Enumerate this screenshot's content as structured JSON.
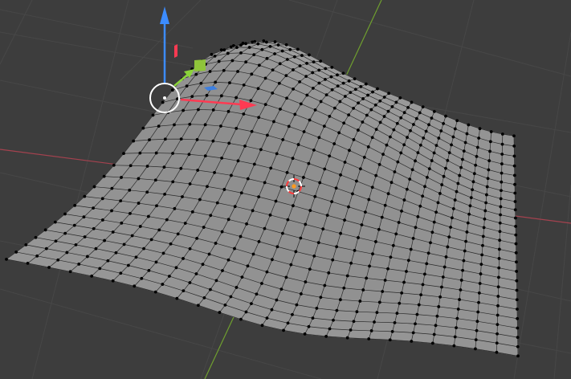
{
  "viewport": {
    "kind": "3d-viewport",
    "mode": "edit-mode",
    "background_color": "#3d3d3d",
    "grid_color": "#474747"
  },
  "axes": {
    "x_axis_color": "#a5424f",
    "y_axis_color": "#6f9f2f"
  },
  "gizmo": {
    "x_color": "#ff3a52",
    "y_color": "#8bd43a",
    "z_color": "#3c8cff",
    "xy_plane_color": "#3c7fe0",
    "xz_plane_color": "#8fc43a",
    "yz_plane_color": "#ff3a52",
    "center_ring_color": "#ffffff"
  },
  "mesh": {
    "type": "subdivided-plane",
    "edit_mode": true,
    "grid_resolution": 24,
    "face_color": "#9d9d9d",
    "edge_color": "#2a2a2a",
    "vertex_color": "#000000"
  },
  "cursor_3d": {
    "ring_colors": [
      "#ff3a3a",
      "#ffffff"
    ],
    "center_color": "#ff9a1f"
  }
}
